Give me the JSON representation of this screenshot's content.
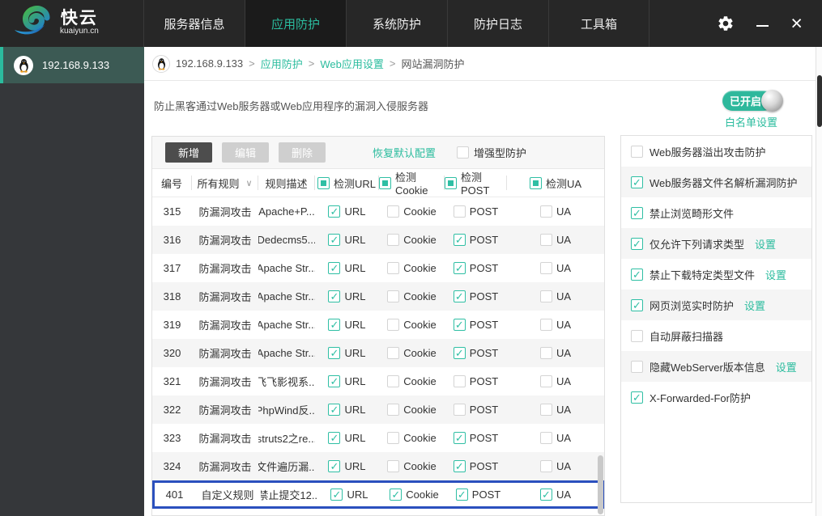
{
  "colors": {
    "accent_teal": "#2bbc9e",
    "toggle_green": "#2eb89c",
    "selected_row_border": "#2b50be",
    "titlebar_bg": "#272727",
    "active_tab_bg": "#1b1b1b",
    "sidebar_bg": "#35373a",
    "sidebar_selected_bg": "#3c5a54",
    "row_stripe": "#f5f5f5",
    "add_button_bg": "#4d4d4d",
    "disabled_button_bg": "#cfcfcf"
  },
  "titlebar": {
    "logo_title": "快云",
    "logo_subtitle": "kuaiyun.cn",
    "nav": [
      {
        "label": "服务器信息",
        "active": false
      },
      {
        "label": "应用防护",
        "active": true
      },
      {
        "label": "系统防护",
        "active": false
      },
      {
        "label": "防护日志",
        "active": false
      },
      {
        "label": "工具箱",
        "active": false
      }
    ],
    "close_glyph": "×"
  },
  "sidebar": {
    "server": {
      "label": "192.168.9.133",
      "selected": true
    }
  },
  "breadcrumb": {
    "server": "192.168.9.133",
    "separator": ">",
    "link1": "应用防护",
    "link2": "Web应用设置",
    "current": "网站漏洞防护"
  },
  "page": {
    "description": "防止黑客通过Web服务器或Web应用程序的漏洞入侵服务器",
    "toggle_label": "已开启",
    "whitelist_link": "白名单设置"
  },
  "toolbar": {
    "add_label": "新增",
    "edit_label": "编辑",
    "delete_label": "删除",
    "restore_label": "恢复默认配置",
    "enhanced_label": "增强型防护",
    "enhanced_checked": false
  },
  "table": {
    "headers": {
      "id": "编号",
      "rules_filter": "所有规则",
      "description": "规则描述",
      "url": "检测URL",
      "cookie": "检测Cookie",
      "post": "检测POST",
      "ua": "检测UA"
    },
    "check_labels": {
      "url": "URL",
      "cookie": "Cookie",
      "post": "POST",
      "ua": "UA"
    },
    "rows": [
      {
        "id": "315",
        "type": "防漏洞攻击",
        "desc": "Apache+P...",
        "url": true,
        "cookie": false,
        "post": false,
        "ua": false,
        "selected": false
      },
      {
        "id": "316",
        "type": "防漏洞攻击",
        "desc": "Dedecms5...",
        "url": true,
        "cookie": false,
        "post": true,
        "ua": false,
        "selected": false
      },
      {
        "id": "317",
        "type": "防漏洞攻击",
        "desc": "Apache Str...",
        "url": true,
        "cookie": false,
        "post": true,
        "ua": false,
        "selected": false
      },
      {
        "id": "318",
        "type": "防漏洞攻击",
        "desc": "Apache Str...",
        "url": true,
        "cookie": false,
        "post": true,
        "ua": false,
        "selected": false
      },
      {
        "id": "319",
        "type": "防漏洞攻击",
        "desc": "Apache Str...",
        "url": true,
        "cookie": false,
        "post": true,
        "ua": false,
        "selected": false
      },
      {
        "id": "320",
        "type": "防漏洞攻击",
        "desc": "Apache Str...",
        "url": true,
        "cookie": false,
        "post": true,
        "ua": false,
        "selected": false
      },
      {
        "id": "321",
        "type": "防漏洞攻击",
        "desc": "飞飞影视系...",
        "url": true,
        "cookie": false,
        "post": false,
        "ua": false,
        "selected": false
      },
      {
        "id": "322",
        "type": "防漏洞攻击",
        "desc": "PhpWind反...",
        "url": true,
        "cookie": false,
        "post": false,
        "ua": false,
        "selected": false
      },
      {
        "id": "323",
        "type": "防漏洞攻击",
        "desc": "struts2之re...",
        "url": true,
        "cookie": false,
        "post": true,
        "ua": false,
        "selected": false
      },
      {
        "id": "324",
        "type": "防漏洞攻击",
        "desc": "文件遍历漏...",
        "url": true,
        "cookie": false,
        "post": true,
        "ua": false,
        "selected": false
      },
      {
        "id": "401",
        "type": "自定义规则",
        "desc": "禁止提交12...",
        "url": true,
        "cookie": true,
        "post": true,
        "ua": true,
        "selected": true
      }
    ]
  },
  "side_options": {
    "settings_label": "设置",
    "items": [
      {
        "label": "Web服务器溢出攻击防护",
        "checked": false,
        "has_settings": false
      },
      {
        "label": "Web服务器文件名解析漏洞防护",
        "checked": true,
        "has_settings": false
      },
      {
        "label": "禁止浏览畸形文件",
        "checked": true,
        "has_settings": false
      },
      {
        "label": "仅允许下列请求类型",
        "checked": true,
        "has_settings": true
      },
      {
        "label": "禁止下载特定类型文件",
        "checked": true,
        "has_settings": true
      },
      {
        "label": "网页浏览实时防护",
        "checked": true,
        "has_settings": true
      },
      {
        "label": "自动屏蔽扫描器",
        "checked": false,
        "has_settings": false
      },
      {
        "label": "隐藏WebServer版本信息",
        "checked": false,
        "has_settings": true
      },
      {
        "label": "X-Forwarded-For防护",
        "checked": true,
        "has_settings": false
      }
    ]
  }
}
